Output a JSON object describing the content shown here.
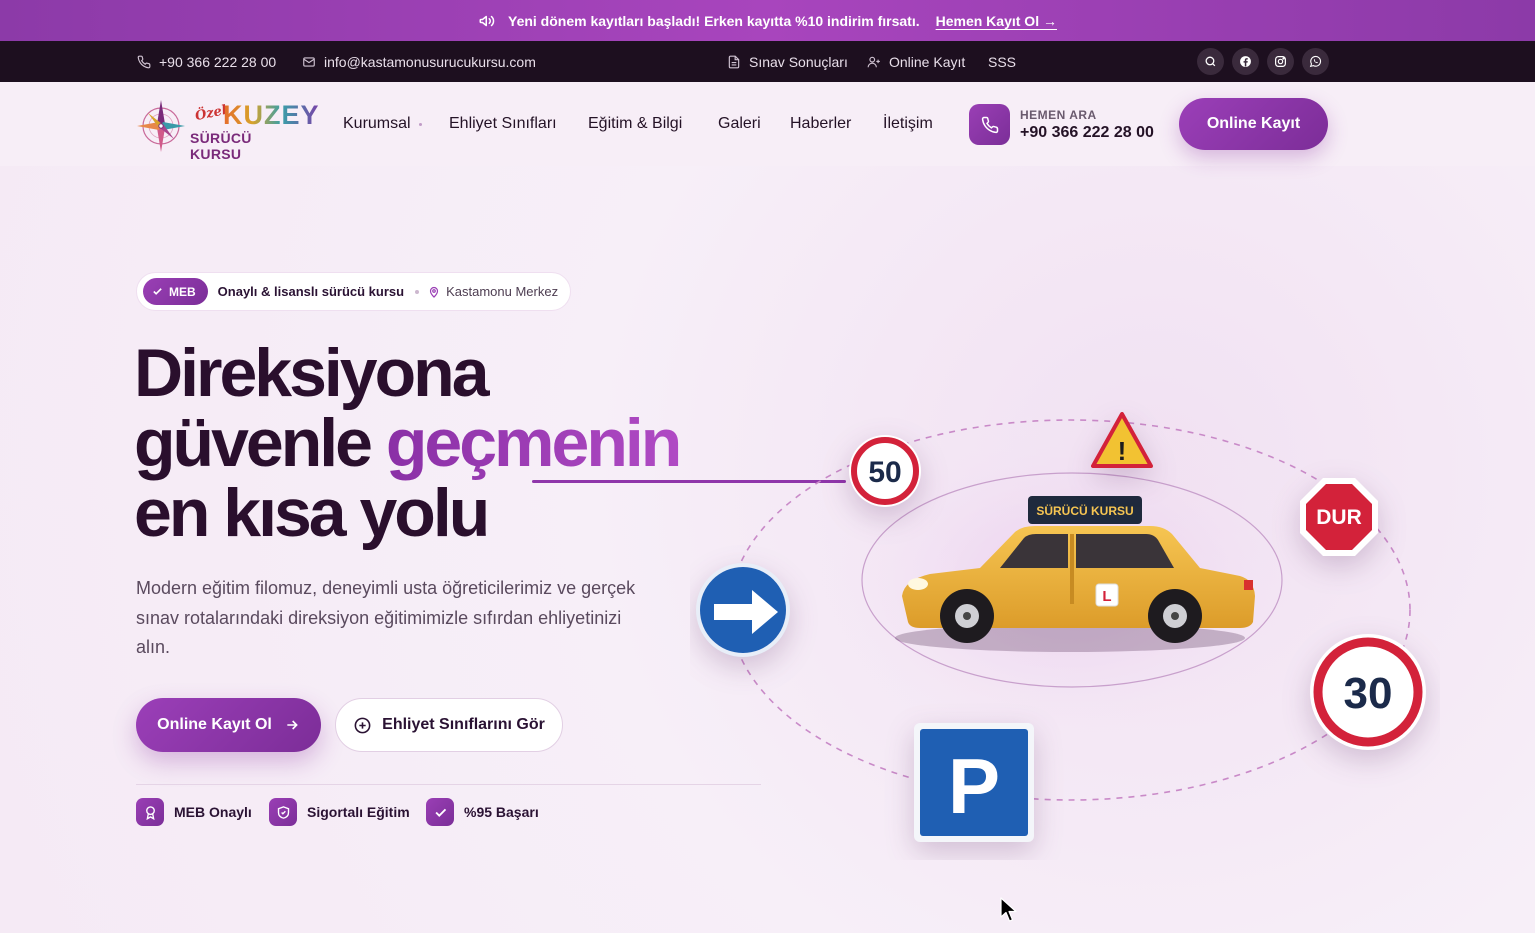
{
  "promo": {
    "text": "Yeni dönem kayıtları başladı! Erken kayıtta %10 indirim fırsatı.",
    "cta": "Hemen Kayıt Ol →"
  },
  "topbar": {
    "phone": "+90 366 222 28 00",
    "email": "info@kastamonusurucukursu.com",
    "links": [
      "Sınav Sonuçları",
      "Online Kayıt",
      "SSS"
    ]
  },
  "logo": {
    "ozel": "Özel",
    "brand": "KUZEY",
    "sub": "SÜRÜCÜ KURSU"
  },
  "nav": {
    "items": [
      "Kurumsal",
      "Ehliyet Sınıfları",
      "Eğitim & Bilgi",
      "Galeri",
      "Haberler",
      "İletişim"
    ]
  },
  "call": {
    "label": "HEMEN ARA",
    "number": "+90 366 222 28 00"
  },
  "header_cta": "Online Kayıt",
  "hero": {
    "badge": "MEB",
    "badge_text": "Onaylı & lisanslı sürücü kursu",
    "location": "Kastamonu Merkez",
    "title_line1": "Direksiyona",
    "title_line2a": "güvenle ",
    "title_line2b": "geçmenin",
    "title_line3": "en kısa yolu",
    "lead": "Modern eğitim filomuz, deneyimli usta öğreticilerimiz ve gerçek sınav rotalarındaki direksiyon eğitimimizle sıfırdan ehliyetinizi alın.",
    "primary_cta": "Online Kayıt Ol",
    "secondary_cta": "Ehliyet Sınıflarını Gör",
    "features": [
      "MEB Onaylı",
      "Sigortalı Eğitim",
      "%95 Başarı"
    ]
  },
  "illustration": {
    "car_sign": "SÜRÜCÜ KURSU",
    "learner_plate": "L",
    "speed_sign_1": "50",
    "speed_sign_2": "30",
    "stop_sign": "DUR",
    "parking_sign": "P",
    "warning_sign": "!"
  },
  "colors": {
    "brand_purple": "#8c3aa8",
    "dark_bar": "#1d0f1f",
    "heading": "#2a0f2d",
    "taxi_yellow": "#f0b63b",
    "sign_blue": "#1f5fb3",
    "sign_red": "#d3223a"
  }
}
